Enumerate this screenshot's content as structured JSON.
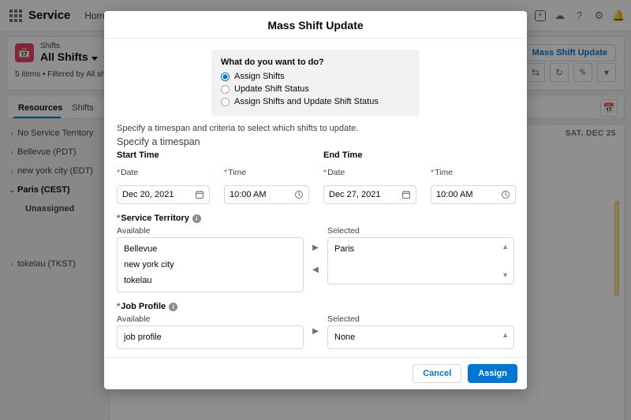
{
  "header": {
    "brand": "Service",
    "nav_item": "Home"
  },
  "listview": {
    "object_label": "Shifts",
    "title": "All Shifts",
    "meta": "5 items • Filtered by All shifts",
    "mass_button": "Mass Shift Update",
    "tabs": {
      "resources": "Resources",
      "shifts": "Shifts"
    },
    "day_header": "SAT, DEC 25",
    "territories": [
      {
        "label": "No Service Territory",
        "expanded": false
      },
      {
        "label": "Bellevue (PDT)",
        "expanded": false
      },
      {
        "label": "new york city (EDT)",
        "expanded": false
      },
      {
        "label": "Paris (CEST)",
        "expanded": true
      },
      {
        "label": "Unassigned",
        "expanded": null
      },
      {
        "label": "tokelau (TKST)",
        "expanded": false
      }
    ]
  },
  "modal": {
    "title": "Mass Shift Update",
    "action_box": {
      "question": "What do you want to do?",
      "options": [
        "Assign Shifts",
        "Update Shift Status",
        "Assign Shifts and Update Shift Status"
      ],
      "selected_index": 0
    },
    "instruction": "Specify a timespan and criteria to select which shifts to update.",
    "timespan_header": "Specify a timespan",
    "start_label": "Start Time",
    "end_label": "End Time",
    "date_label": "Date",
    "time_label": "Time",
    "start_date": "Dec 20, 2021",
    "start_time": "10:00 AM",
    "end_date": "Dec 27, 2021",
    "end_time": "10:00 AM",
    "service_territory_label": "Service Territory",
    "job_profile_label": "Job Profile",
    "available_label": "Available",
    "selected_label": "Selected",
    "territory_available": [
      "Bellevue",
      "new york city",
      "tokelau"
    ],
    "territory_selected": [
      "Paris"
    ],
    "job_available": [
      "job profile"
    ],
    "job_selected": [
      "None"
    ],
    "footer": {
      "cancel": "Cancel",
      "assign": "Assign"
    }
  }
}
